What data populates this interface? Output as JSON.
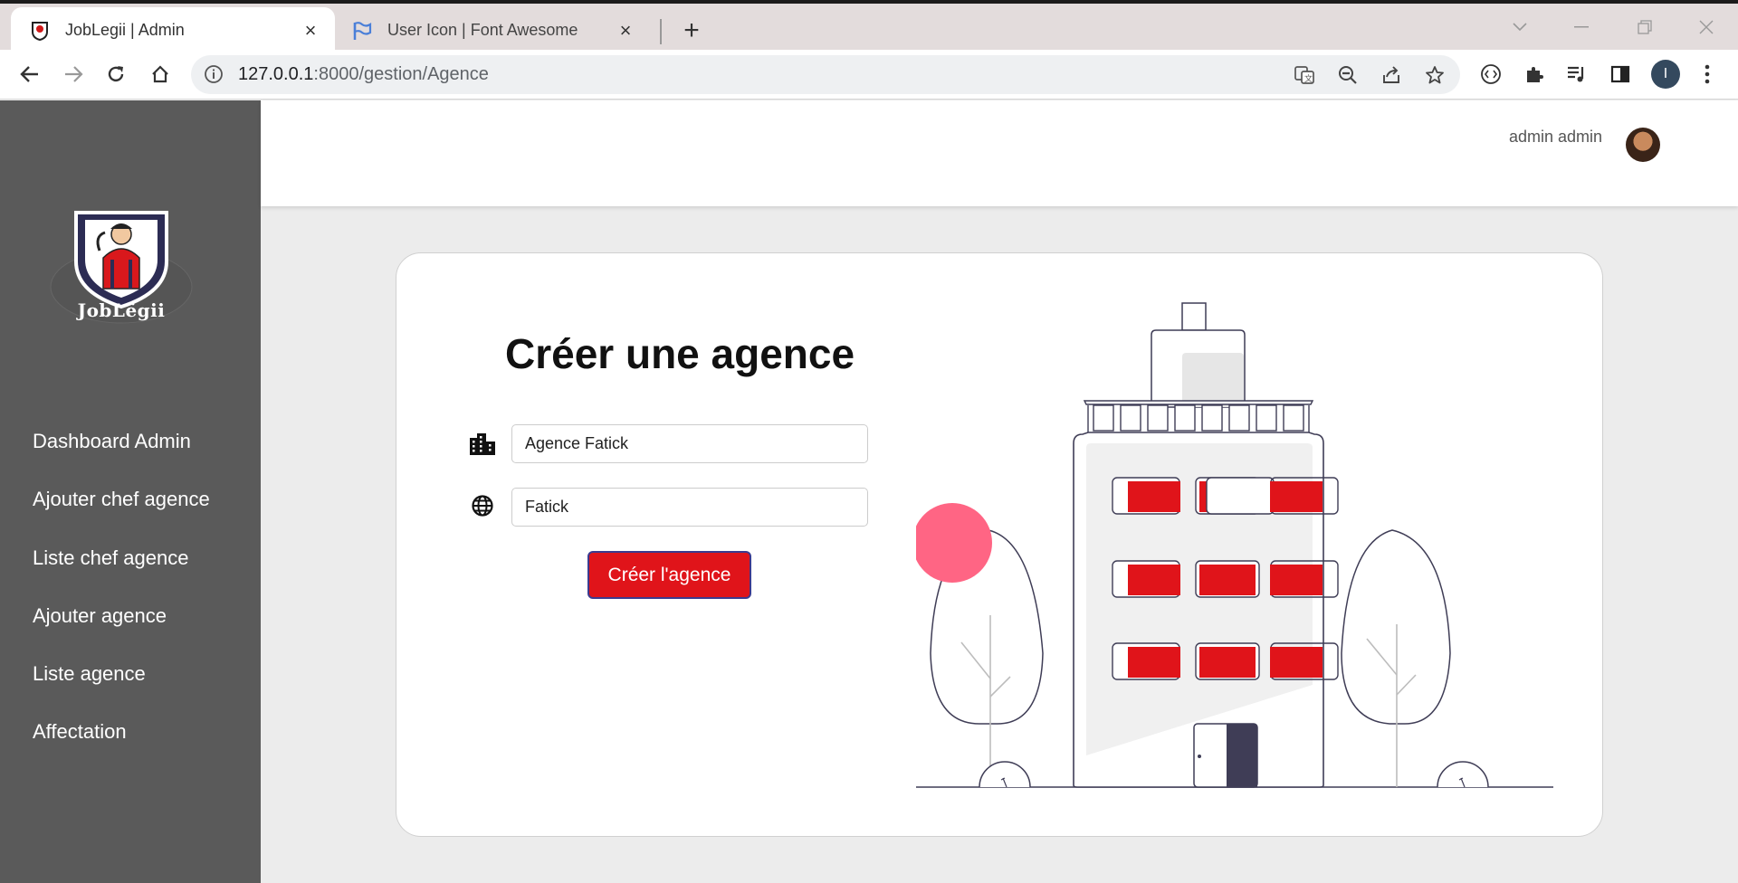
{
  "browser": {
    "tabs": [
      {
        "title": "JobLegii | Admin",
        "active": true
      },
      {
        "title": "User Icon | Font Awesome",
        "active": false
      }
    ],
    "url_host": "127.0.0.1",
    "url_path": ":8000/gestion/Agence",
    "profile_initial": "I"
  },
  "sidebar": {
    "logo_text": "JobLëgii",
    "items": [
      {
        "label": "Dashboard Admin"
      },
      {
        "label": "Ajouter chef agence"
      },
      {
        "label": "Liste chef agence"
      },
      {
        "label": "Ajouter agence"
      },
      {
        "label": "Liste agence"
      },
      {
        "label": "Affectation"
      }
    ]
  },
  "header": {
    "username": "admin admin"
  },
  "form": {
    "title": "Créer une agence",
    "name_value": "Agence Fatick",
    "city_value": "Fatick",
    "submit_label": "Créer l'agence"
  },
  "colors": {
    "sidebar": "#5a5a5a",
    "accent": "#e0141a",
    "background": "#ececec",
    "illustration_circle": "#ff6584"
  },
  "icons": [
    "city-icon",
    "globe-icon",
    "building-illustration"
  ]
}
